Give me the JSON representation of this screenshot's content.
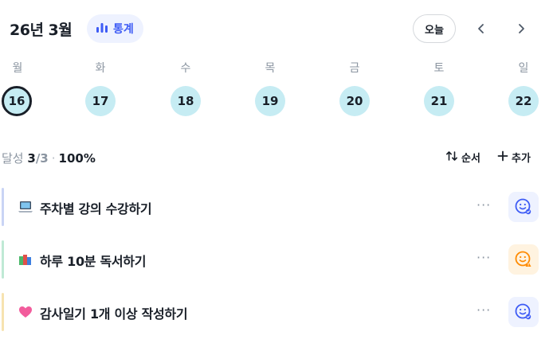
{
  "header": {
    "title": "26년 3월",
    "stats_label": "통계",
    "today_label": "오늘",
    "prev_icon": "chevron-left-icon",
    "next_icon": "chevron-right-icon"
  },
  "week": {
    "weekdays": [
      "월",
      "화",
      "수",
      "목",
      "금",
      "토",
      "일"
    ],
    "days": [
      "16",
      "17",
      "18",
      "19",
      "20",
      "21",
      "22"
    ],
    "selected_day": "16"
  },
  "summary": {
    "label": "달성",
    "count": "3",
    "total": "/3",
    "separator": "·",
    "percent": "100%"
  },
  "toolbar": {
    "order_label": "순서",
    "add_label": "추가",
    "order_icon": "sort-arrows-icon",
    "add_icon": "plus-icon"
  },
  "tasks": [
    {
      "title": "주차별 강의 수강하기",
      "emoji": "laptop-icon",
      "accent": "#c9d4f5",
      "more": "···",
      "status": "smile-blue",
      "status_color": "#3d5bf5",
      "status_bg": "#eef2ff"
    },
    {
      "title": "하루 10분 독서하기",
      "emoji": "books-icon",
      "accent": "#bfe9d5",
      "more": "···",
      "status": "smile-orange",
      "status_color": "#ff8a00",
      "status_bg": "#fff3e0"
    },
    {
      "title": "감사일기 1개 이상 작성하기",
      "emoji": "heart-icon",
      "accent": "#f7e3b0",
      "more": "···",
      "status": "smile-blue",
      "status_color": "#3d5bf5",
      "status_bg": "#eef2ff"
    }
  ],
  "colors": {
    "accent_blue": "#3d5bf5",
    "day_circle": "#c6ecf3",
    "muted_text": "#8b95a1"
  }
}
